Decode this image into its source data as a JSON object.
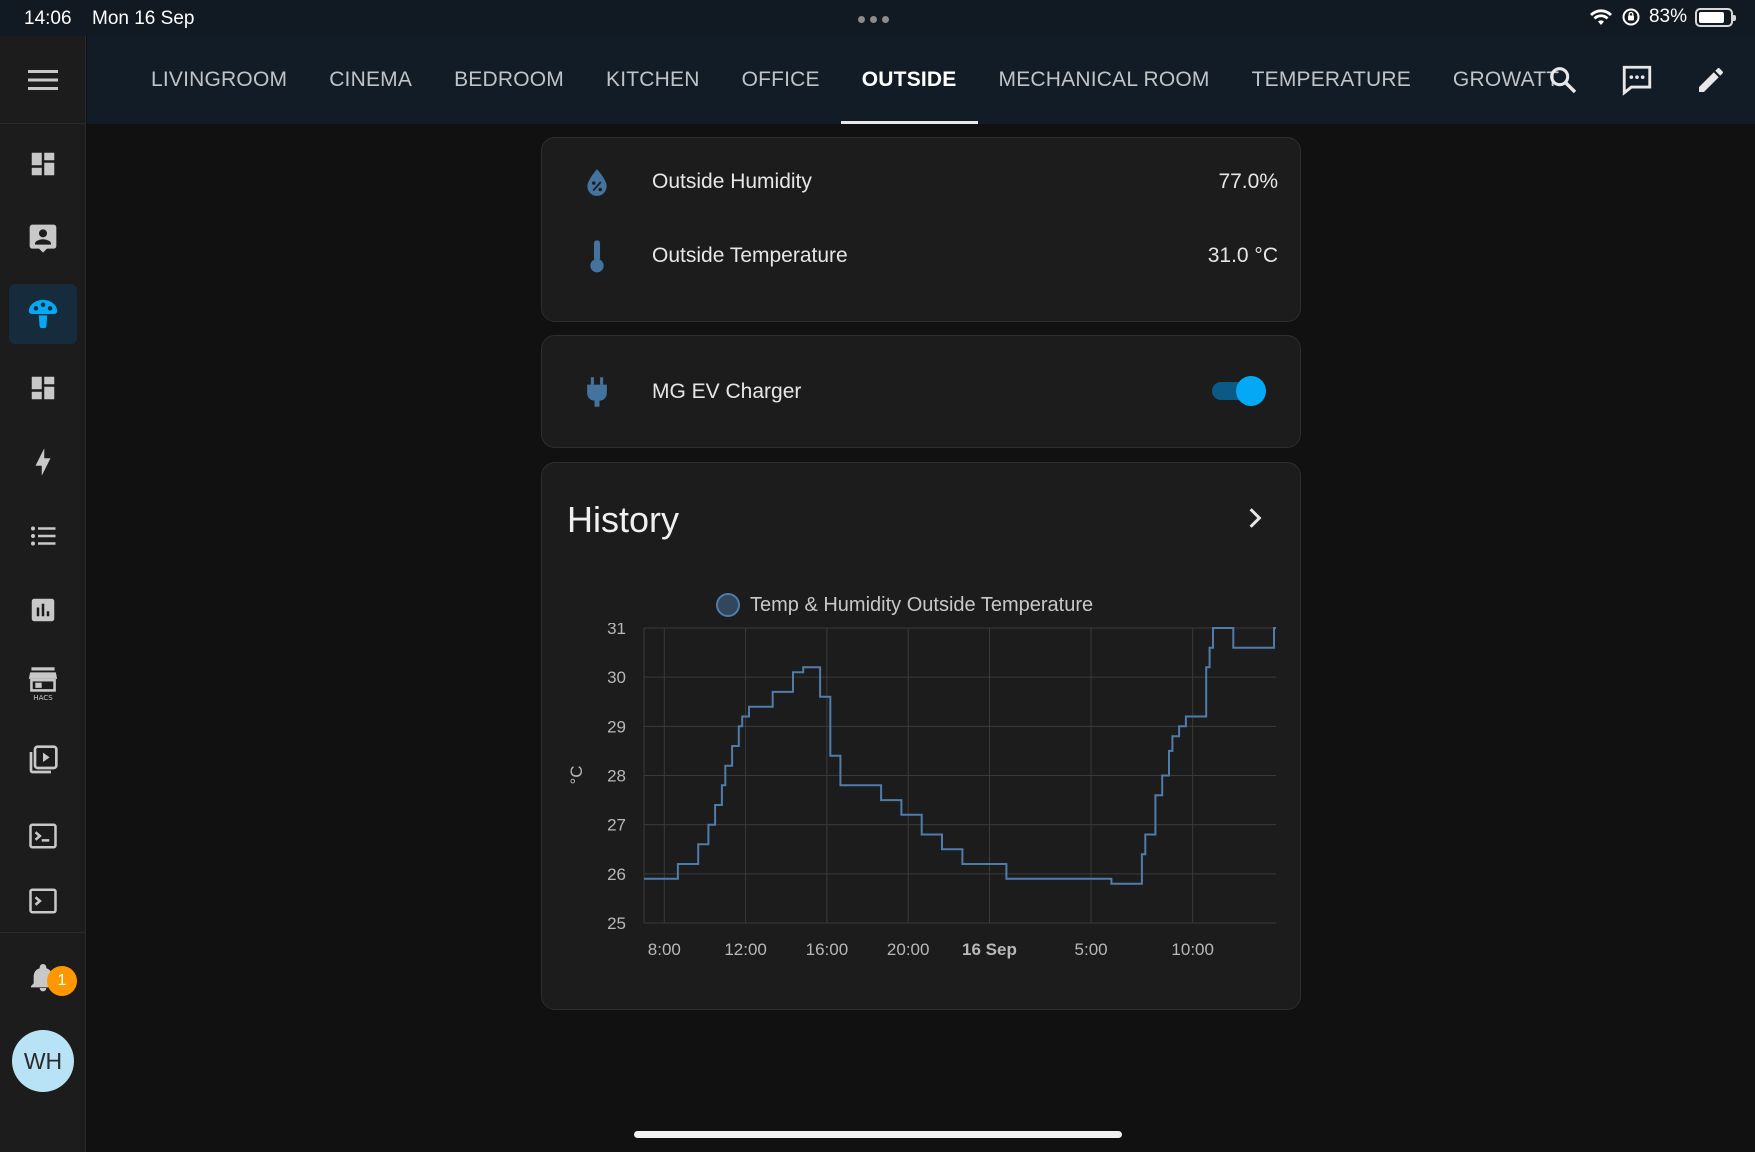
{
  "status_bar": {
    "time": "14:06",
    "date": "Mon 16 Sep",
    "battery": "83%",
    "battery_level": 0.83,
    "icons": [
      "wifi-icon",
      "orientation-lock-icon",
      "battery-icon"
    ]
  },
  "sidebar": {
    "items": [
      {
        "icon": "menu-icon"
      },
      {
        "icon": "dashboard-icon"
      },
      {
        "icon": "contact-card-icon"
      },
      {
        "icon": "mushroom-icon",
        "active": true
      },
      {
        "icon": "dashboard-icon"
      },
      {
        "icon": "lightning-bolt-icon"
      },
      {
        "icon": "format-list-bulleted-icon"
      },
      {
        "icon": "chart-box-icon"
      },
      {
        "icon": "hacs-store-icon"
      },
      {
        "icon": "play-box-multiple-icon"
      },
      {
        "icon": "console-icon"
      },
      {
        "icon": "console-partial-icon"
      }
    ],
    "notifications_badge": "1",
    "avatar_initials": "WH"
  },
  "tabs": [
    {
      "label": "LIVINGROOM"
    },
    {
      "label": "CINEMA"
    },
    {
      "label": "BEDROOM"
    },
    {
      "label": "KITCHEN"
    },
    {
      "label": "OFFICE"
    },
    {
      "label": "OUTSIDE",
      "active": true
    },
    {
      "label": "MECHANICAL ROOM"
    },
    {
      "label": "TEMPERATURE"
    },
    {
      "label": "GROWATT"
    }
  ],
  "top_icons": [
    "search-icon",
    "assist-chat-icon",
    "edit-pencil-icon"
  ],
  "sensors_card": {
    "rows": [
      {
        "icon": "water-percent-icon",
        "name": "Outside Humidity",
        "value": "77.0%"
      },
      {
        "icon": "thermometer-icon",
        "name": "Outside Temperature",
        "value": "31.0 °C"
      }
    ]
  },
  "switch_card": {
    "icon": "power-plug-icon",
    "name": "MG EV Charger",
    "state": "on"
  },
  "history_card": {
    "title": "History",
    "legend": "Temp & Humidity Outside Temperature"
  },
  "colors": {
    "accent": "#03a9f4",
    "icon_blue": "#44739e",
    "line": "#4f7cab",
    "badge": "#ff9800"
  },
  "chart_data": {
    "type": "line",
    "step": true,
    "ylabel": "°C",
    "ylim": [
      25,
      31
    ],
    "yticks": [
      25,
      26,
      27,
      28,
      29,
      30,
      31
    ],
    "xlim": [
      "15 Sep 07:00",
      "16 Sep 14:06"
    ],
    "xticks": [
      {
        "label": "8:00",
        "t": "15 Sep 08:00"
      },
      {
        "label": "12:00",
        "t": "15 Sep 12:00"
      },
      {
        "label": "16:00",
        "t": "15 Sep 16:00"
      },
      {
        "label": "20:00",
        "t": "15 Sep 20:00"
      },
      {
        "label": "16 Sep",
        "t": "16 Sep 00:00",
        "bold": true
      },
      {
        "label": "5:00",
        "t": "16 Sep 05:00"
      },
      {
        "label": "10:00",
        "t": "16 Sep 10:00"
      }
    ],
    "grid": true,
    "series": [
      {
        "name": "Temp & Humidity Outside Temperature",
        "x": [
          "15 Sep 07:00",
          "15 Sep 08:40",
          "15 Sep 09:40",
          "15 Sep 10:10",
          "15 Sep 10:30",
          "15 Sep 10:50",
          "15 Sep 11:00",
          "15 Sep 11:20",
          "15 Sep 11:40",
          "15 Sep 11:50",
          "15 Sep 12:10",
          "15 Sep 13:20",
          "15 Sep 14:20",
          "15 Sep 14:50",
          "15 Sep 15:40",
          "15 Sep 16:10",
          "15 Sep 16:40",
          "15 Sep 18:40",
          "15 Sep 19:40",
          "15 Sep 20:40",
          "15 Sep 21:40",
          "15 Sep 22:40",
          "16 Sep 00:50",
          "16 Sep 06:00",
          "16 Sep 07:30",
          "16 Sep 07:40",
          "16 Sep 08:10",
          "16 Sep 08:30",
          "16 Sep 08:50",
          "16 Sep 09:00",
          "16 Sep 09:20",
          "16 Sep 09:40",
          "16 Sep 10:40",
          "16 Sep 10:50",
          "16 Sep 11:00",
          "16 Sep 12:00",
          "16 Sep 14:00"
        ],
        "y": [
          25.9,
          26.2,
          26.6,
          27.0,
          27.4,
          27.8,
          28.2,
          28.6,
          29.0,
          29.2,
          29.4,
          29.7,
          30.1,
          30.2,
          29.6,
          28.4,
          27.8,
          27.5,
          27.2,
          26.8,
          26.5,
          26.2,
          25.9,
          25.8,
          26.4,
          26.8,
          27.6,
          28.0,
          28.5,
          28.8,
          29.0,
          29.2,
          30.2,
          30.6,
          31.0,
          30.6,
          31.0
        ]
      }
    ]
  }
}
